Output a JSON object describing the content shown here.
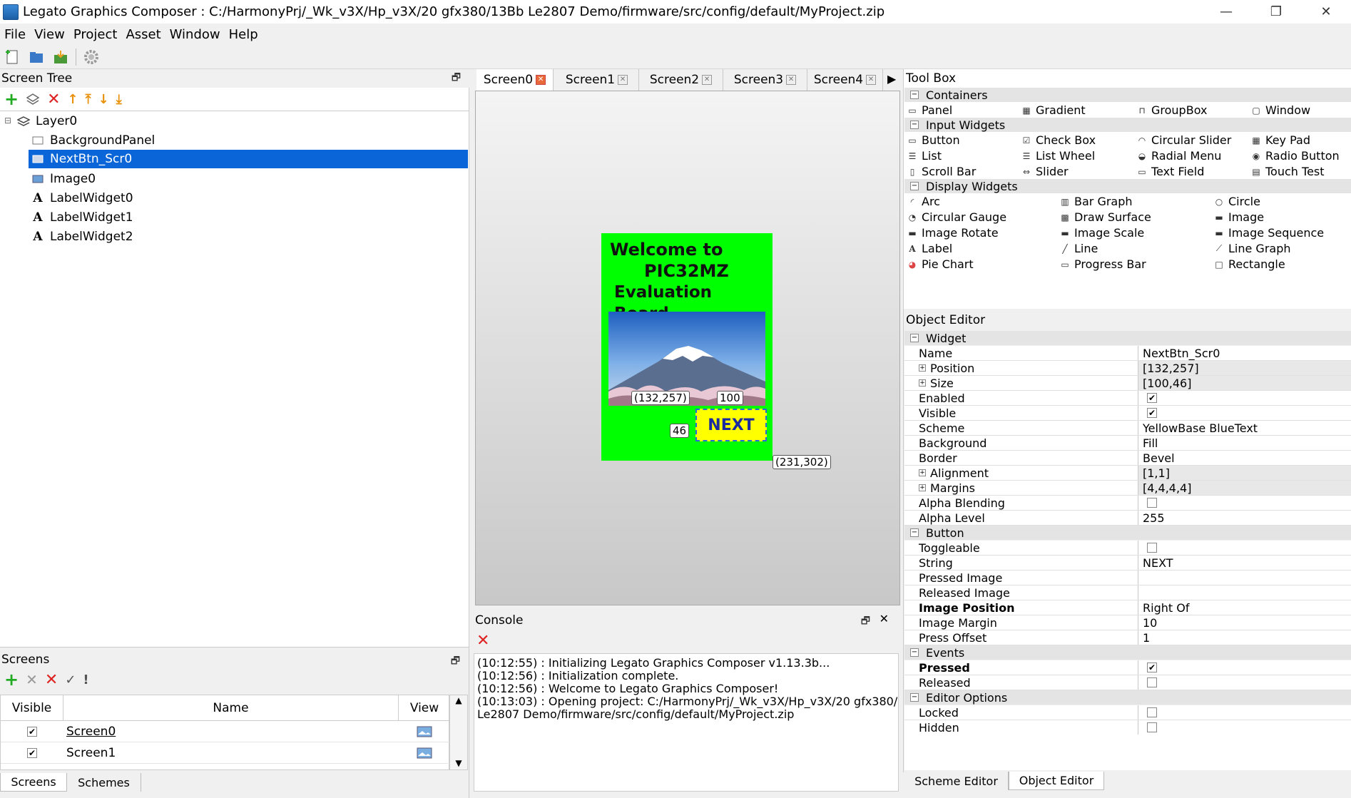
{
  "window": {
    "title": "Legato Graphics Composer : C:/HarmonyPrj/_Wk_v3X/Hp_v3X/20 gfx380/13Bb Le2807 Demo/firmware/src/config/default/MyProject.zip",
    "minimize": "—",
    "restore": "❐",
    "close": "✕"
  },
  "menu": [
    "File",
    "View",
    "Project",
    "Asset",
    "Window",
    "Help"
  ],
  "screen_tree": {
    "title": "Screen Tree",
    "float": "🗗",
    "nodes": [
      {
        "label": "Layer0",
        "icon": "layer-icon"
      },
      {
        "label": "BackgroundPanel",
        "icon": "panel-icon"
      },
      {
        "label": "NextBtn_Scr0",
        "icon": "button-icon"
      },
      {
        "label": "Image0",
        "icon": "image-icon"
      },
      {
        "label": "LabelWidget0",
        "icon": "label-icon"
      },
      {
        "label": "LabelWidget1",
        "icon": "label-icon"
      },
      {
        "label": "LabelWidget2",
        "icon": "label-icon"
      }
    ],
    "collapse": "⊟"
  },
  "screens_panel": {
    "title": "Screens",
    "float": "🗗",
    "columns": [
      "Visible",
      "Name",
      "View"
    ],
    "rows": [
      {
        "visible": "✔",
        "name": "Screen0"
      },
      {
        "visible": "✔",
        "name": "Screen1"
      }
    ],
    "bottom_tabs": [
      "Screens",
      "Schemes"
    ]
  },
  "tabs": [
    "Screen0",
    "Screen1",
    "Screen2",
    "Screen3",
    "Screen4"
  ],
  "tab_close": "✕",
  "tab_arrow": "▶",
  "canvas": {
    "title_lines": [
      "Welcome to",
      "PIC32MZ",
      "Evaluation Board"
    ],
    "button_text": "NEXT",
    "pos_label": "(132,257)",
    "width_label": "100",
    "height_label": "46",
    "end_label": "(231,302)",
    "colors": {
      "bg": "#00ff00",
      "button": "#ffff00",
      "button_text": "#1a2aa0"
    }
  },
  "console": {
    "title": "Console",
    "float": "🗗",
    "close": "✕",
    "lines": [
      "(10:12:55) : Initializing Legato Graphics Composer v1.13.3b...",
      "(10:12:56) : Initialization complete.",
      "(10:12:56) : Welcome to Legato Graphics Composer!",
      "(10:13:03) : Opening project: C:/HarmonyPrj/_Wk_v3X/Hp_v3X/20 gfx380/13Bb",
      "Le2807 Demo/firmware/src/config/default/MyProject.zip"
    ]
  },
  "toolbox": {
    "title": "Tool Box",
    "categories": [
      {
        "name": "Containers",
        "items": [
          "Panel",
          "Gradient",
          "GroupBox",
          "Window"
        ]
      },
      {
        "name": "Input Widgets",
        "items": [
          "Button",
          "Check Box",
          "Circular Slider",
          "Key Pad",
          "List",
          "List Wheel",
          "Radial Menu",
          "Radio Button",
          "Scroll Bar",
          "Slider",
          "Text Field",
          "Touch Test"
        ]
      },
      {
        "name": "Display Widgets",
        "items": [
          "Arc",
          "Bar Graph",
          "Circle",
          "Circular Gauge",
          "Draw Surface",
          "Image",
          "Image Rotate",
          "Image Scale",
          "Image Sequence",
          "Label",
          "Line",
          "Line Graph",
          "Pie Chart",
          "Progress Bar",
          "Rectangle"
        ]
      }
    ]
  },
  "object_editor": {
    "title": "Object Editor",
    "groups": [
      {
        "name": "Widget",
        "props": [
          {
            "name": "Name",
            "value": "NextBtn_Scr0"
          },
          {
            "name": "Position",
            "value": "[132,257]",
            "expand": true
          },
          {
            "name": "Size",
            "value": "[100,46]",
            "expand": true
          },
          {
            "name": "Enabled",
            "check": true
          },
          {
            "name": "Visible",
            "check": true
          },
          {
            "name": "Scheme",
            "value": "YellowBase BlueText"
          },
          {
            "name": "Background",
            "value": "Fill"
          },
          {
            "name": "Border",
            "value": "Bevel"
          },
          {
            "name": "Alignment",
            "value": "[1,1]",
            "expand": true
          },
          {
            "name": "Margins",
            "value": "[4,4,4,4]",
            "expand": true
          },
          {
            "name": "Alpha Blending",
            "check": false
          },
          {
            "name": "Alpha Level",
            "value": "255"
          }
        ]
      },
      {
        "name": "Button",
        "props": [
          {
            "name": "Toggleable",
            "check": false
          },
          {
            "name": "String",
            "value": "NEXT"
          },
          {
            "name": "Pressed Image",
            "value": ""
          },
          {
            "name": "Released Image",
            "value": ""
          },
          {
            "name": "Image Position",
            "value": "Right Of",
            "bold": true
          },
          {
            "name": "Image Margin",
            "value": "10"
          },
          {
            "name": "Press Offset",
            "value": "1"
          }
        ]
      },
      {
        "name": "Events",
        "props": [
          {
            "name": "Pressed",
            "check": true,
            "bold": true
          },
          {
            "name": "Released",
            "check": false
          }
        ]
      },
      {
        "name": "Editor Options",
        "props": [
          {
            "name": "Locked",
            "check": false
          },
          {
            "name": "Hidden",
            "check": false
          }
        ]
      }
    ],
    "bottom_tabs": [
      "Scheme Editor",
      "Object Editor"
    ]
  }
}
